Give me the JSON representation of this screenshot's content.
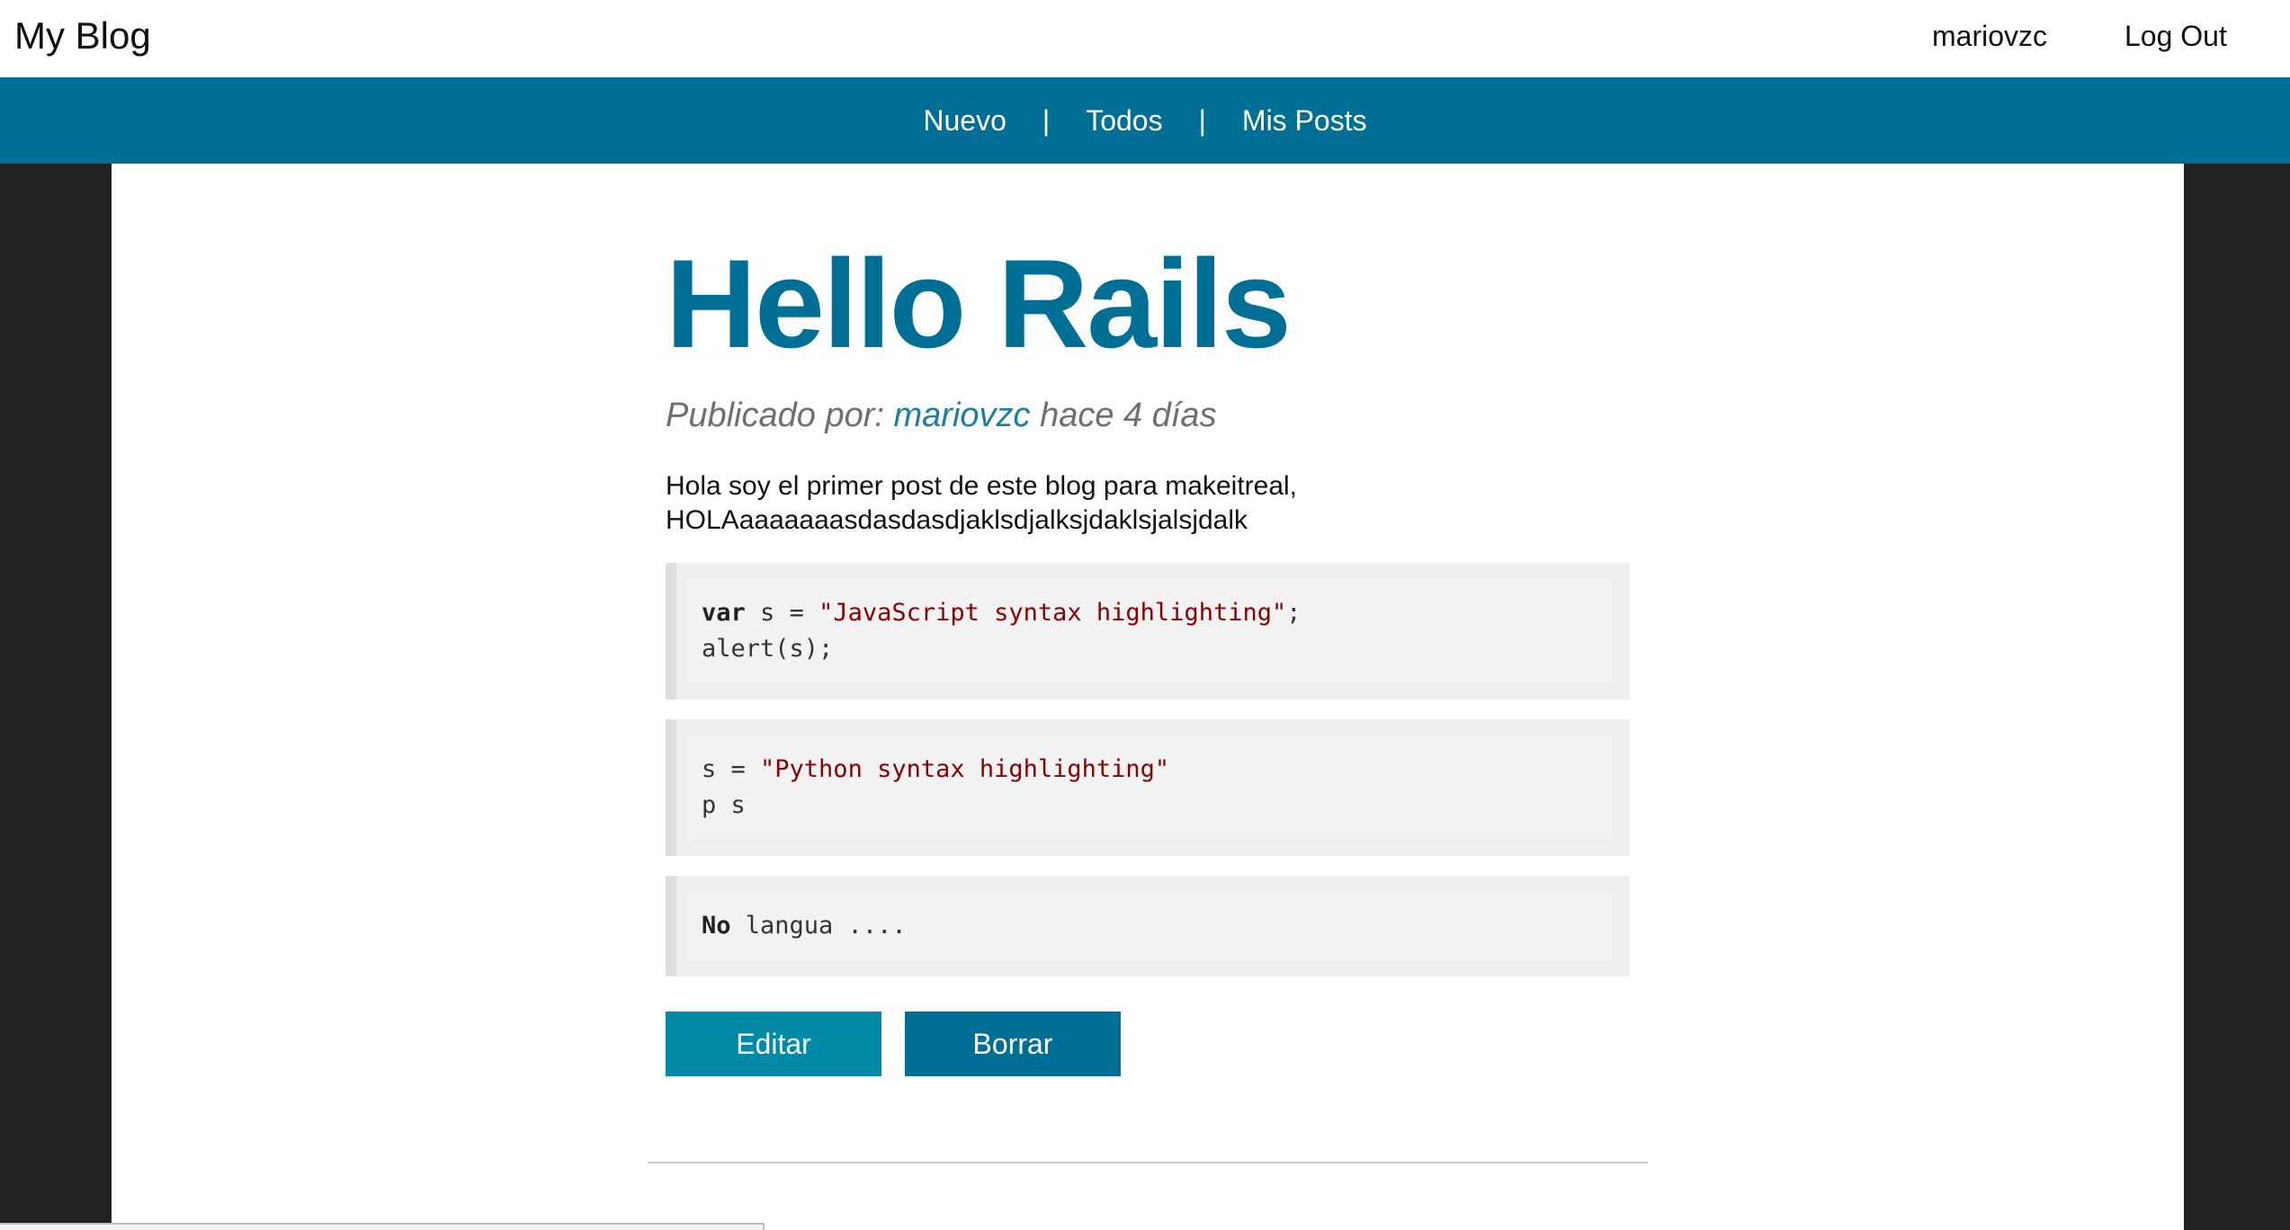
{
  "header": {
    "brand": "My Blog",
    "username": "mariovzc",
    "logout_label": "Log Out"
  },
  "nav": {
    "items": [
      {
        "label": "Nuevo"
      },
      {
        "label": "Todos"
      },
      {
        "label": "Mis Posts"
      }
    ],
    "separator": "|"
  },
  "post": {
    "title": "Hello Rails",
    "meta_prefix": "Publicado por:",
    "author": "mariovzc",
    "meta_time": "hace 4 días",
    "body_line1": "Hola soy el primer post de este blog para makeitreal,",
    "body_line2": "HOLAaaaaaaasdasdasdjaklsdjalksjdaklsjalsjdalk",
    "code_blocks": [
      {
        "line1_kw": "var",
        "line1_mid": " s = ",
        "line1_str": "\"JavaScript syntax highlighting\"",
        "line1_end": ";",
        "line2": "alert(s);"
      },
      {
        "line1_mid": "s = ",
        "line1_str": "\"Python syntax highlighting\"",
        "line2": "p s"
      },
      {
        "line1_kw": "No",
        "line1_mid": " langua ...."
      }
    ],
    "edit_label": "Editar",
    "delete_label": "Borrar"
  },
  "colors": {
    "brand_blue": "#006f96",
    "edit_button": "#008aa6",
    "link_blue": "#1a7fa3",
    "string_red": "#8b0000",
    "page_dark": "#222222"
  }
}
